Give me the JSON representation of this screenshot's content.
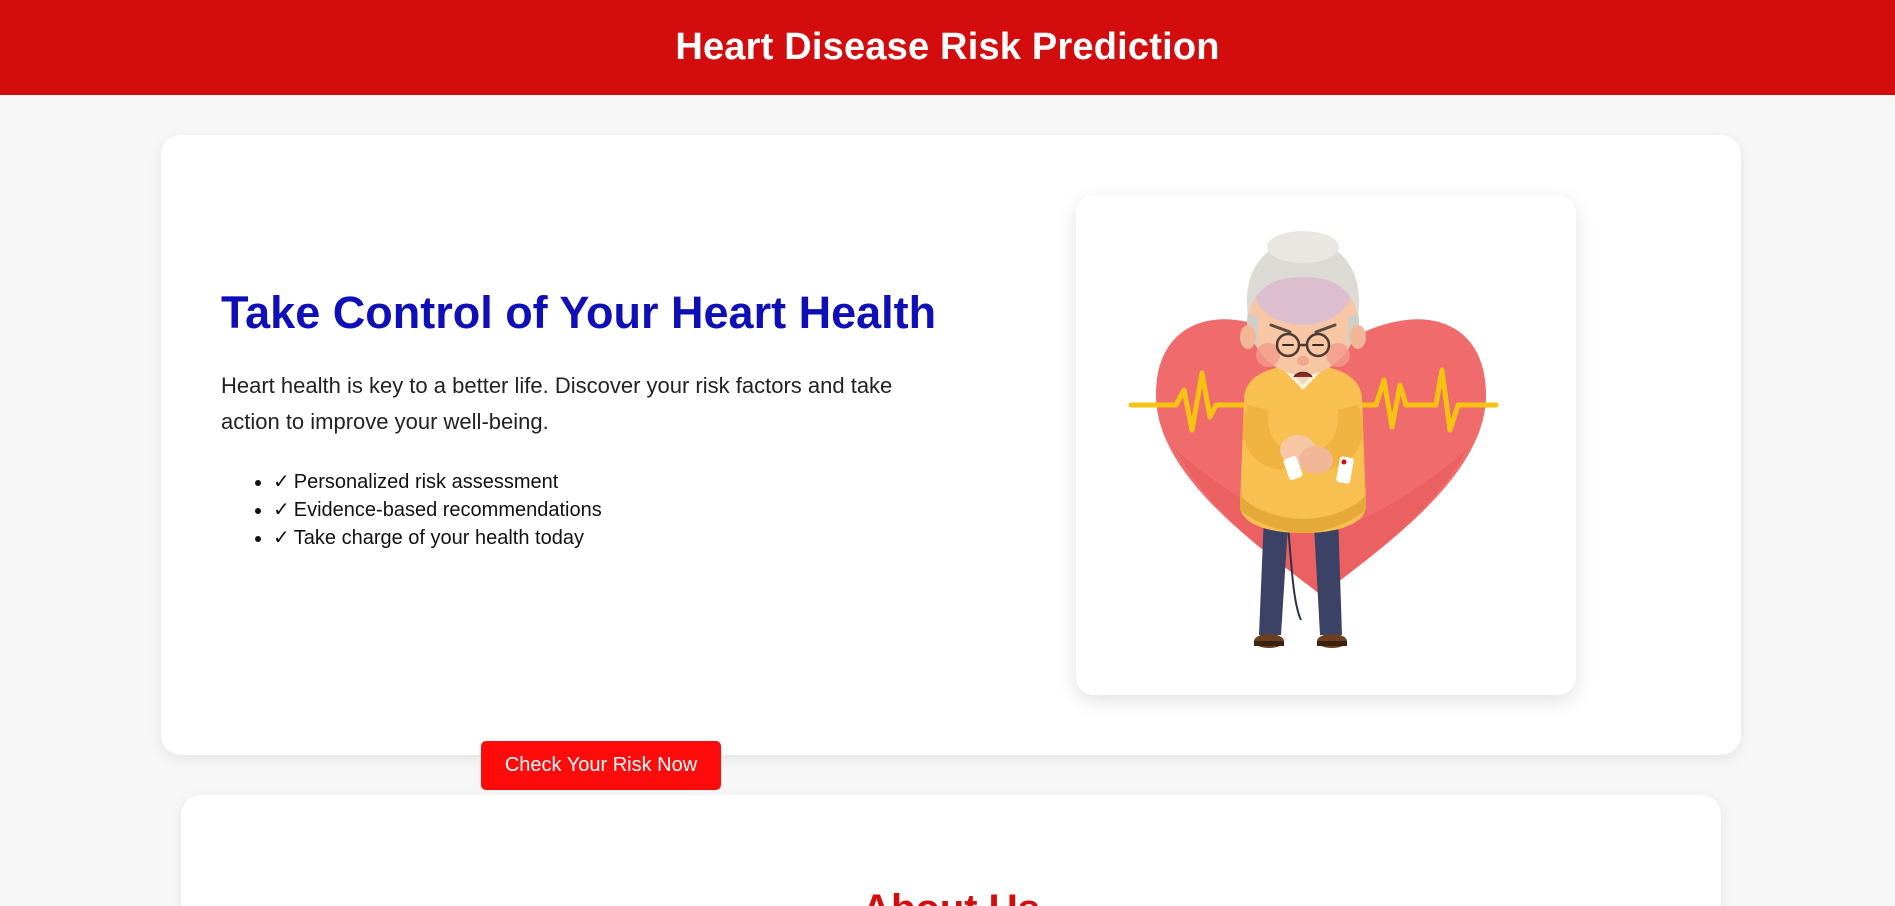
{
  "header": {
    "title": "Heart Disease Risk Prediction"
  },
  "hero": {
    "heading": "Take Control of Your Heart Health",
    "description": "Heart health is key to a better life. Discover your risk factors and take action to improve your well-being.",
    "check_glyph": "✓",
    "features": [
      "Personalized risk assessment",
      "Evidence-based recommendations",
      "Take charge of your health today"
    ],
    "cta_label": "Check Your Risk Now"
  },
  "about": {
    "heading": "About Us"
  },
  "colors": {
    "header_bg": "#d30d0d",
    "heading_blue": "#0f0fb8",
    "cta_red": "#ff0b0b",
    "heart": "#f06b6b",
    "ecg_line": "#f7c313"
  },
  "illustration": {
    "icon": "elderly-man-heart-pain-illustration"
  }
}
